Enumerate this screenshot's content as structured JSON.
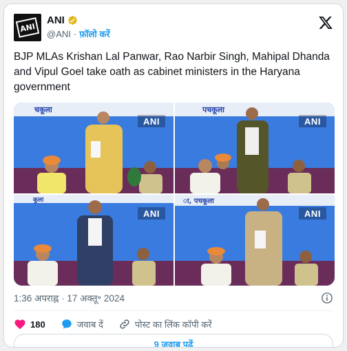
{
  "author": {
    "display_name": "ANI",
    "handle": "@ANI",
    "separator": "·",
    "follow_label": "फ़ॉलो करें",
    "avatar_text": "ANI"
  },
  "tweet": {
    "text": "BJP MLAs Krishan Lal Panwar, Rao Narbir Singh, Mahipal Dhanda and Vipul Goel take oath as cabinet ministers in the Haryana government"
  },
  "media": {
    "watermark": "ANI",
    "banner_texts": [
      "चकूला",
      "पचकूला",
      "कूला",
      "ा, पचकूला"
    ]
  },
  "timestamp": "1:36 अपराह्न · 17 अक्तू॰ 2024",
  "actions": {
    "like_count": "180",
    "reply_label": "जवाब दें",
    "copy_link_label": "पोस्ट का लिंक कॉपी करें"
  },
  "replies_button": "9 जवाब पढ़ें",
  "colors": {
    "accent": "#1d9bf0",
    "like": "#f91880",
    "backdrop_blue": "#2f6fd6"
  }
}
